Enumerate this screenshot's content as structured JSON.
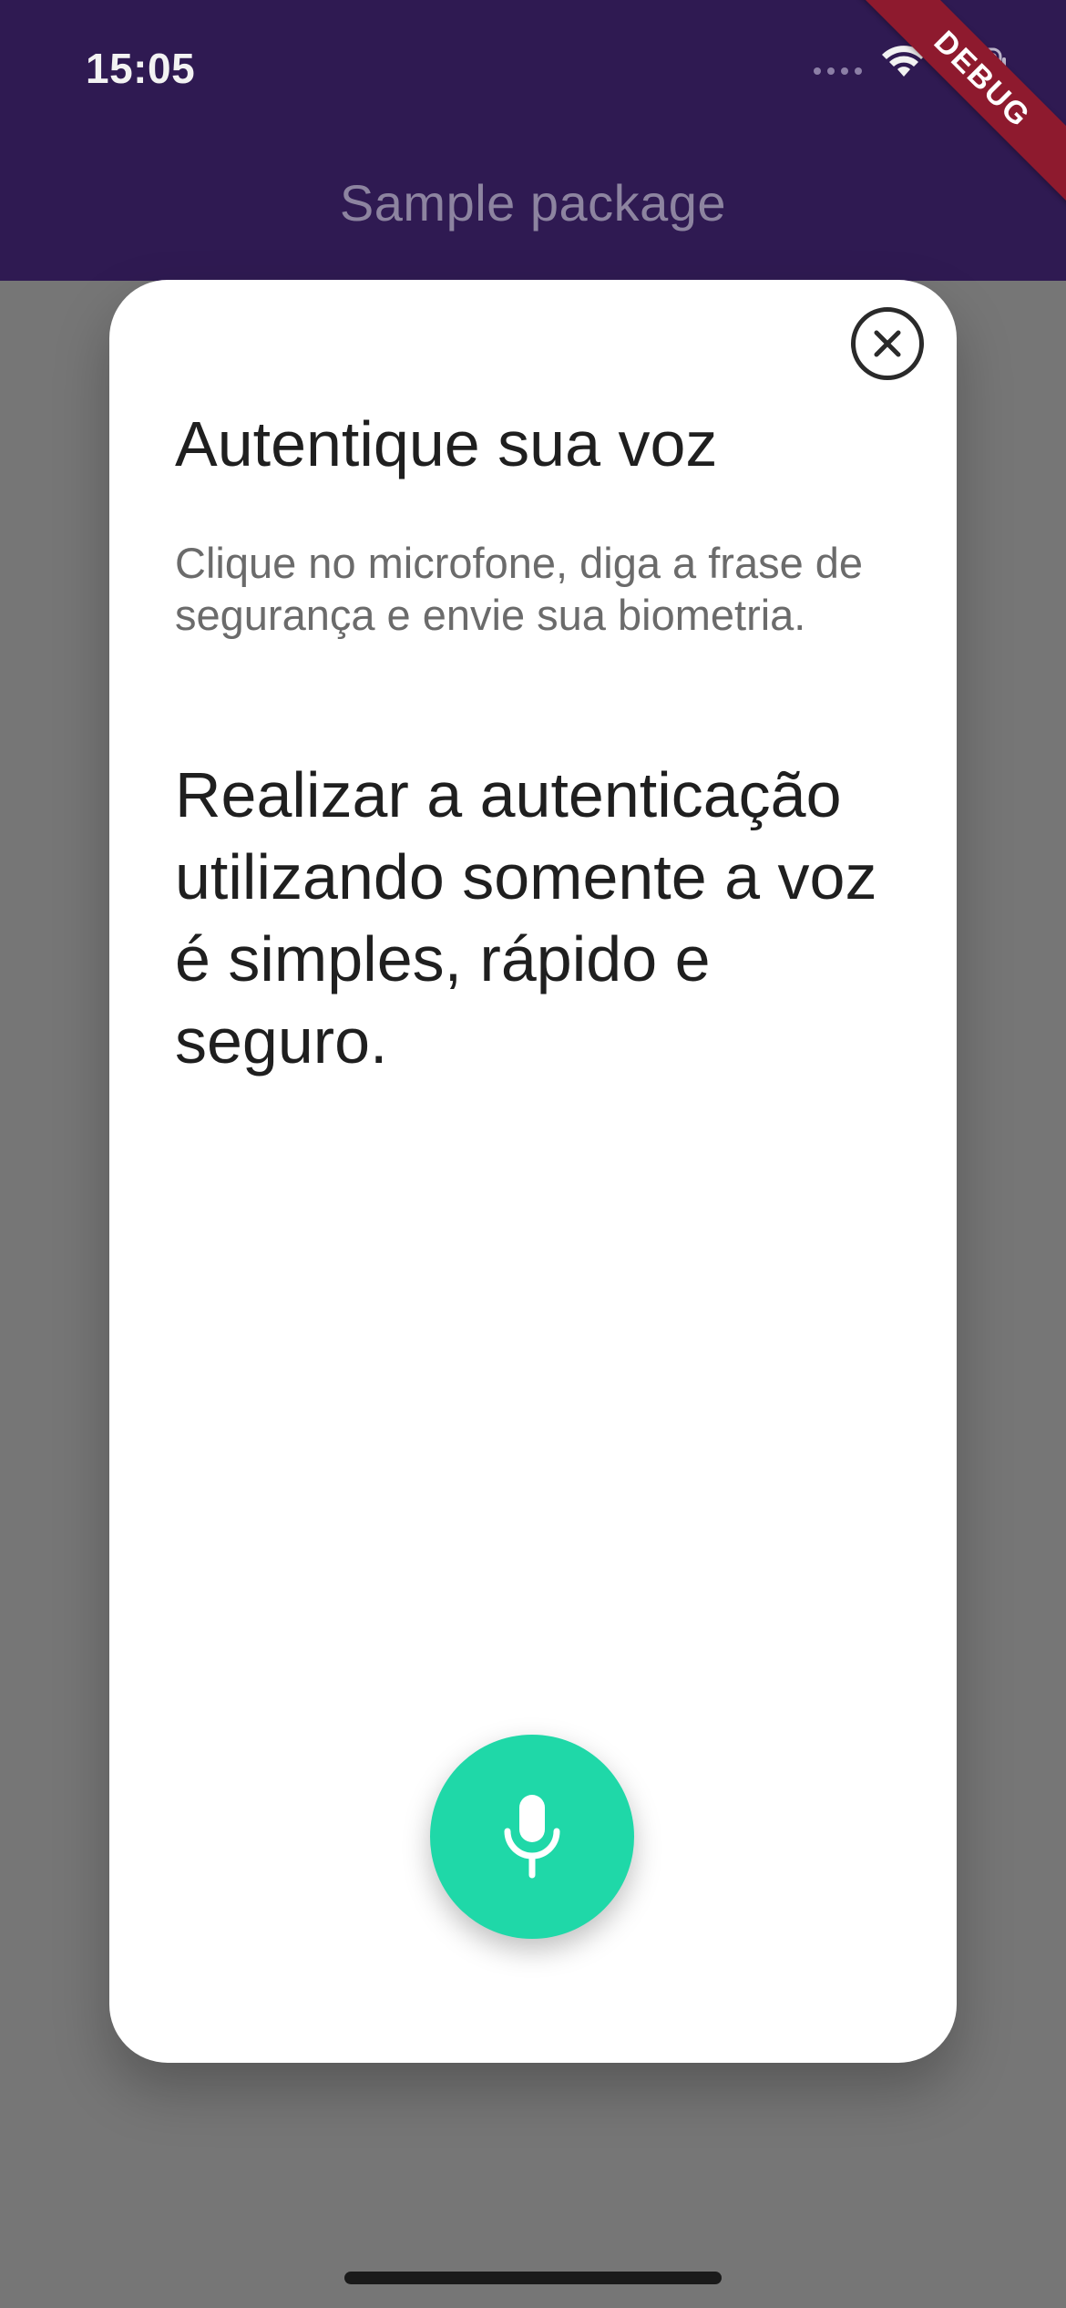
{
  "status_bar": {
    "time": "15:05"
  },
  "app_bar": {
    "title": "Sample package"
  },
  "debug_banner": {
    "label": "DEBUG"
  },
  "modal": {
    "title": "Autentique sua voz",
    "subtitle": "Clique no microfone, diga a frase de segurança e envie sua biometria.",
    "statement": "Realizar a autenticação utilizando somente a voz é simples, rápido e seguro.",
    "close_icon": "close-circle-icon",
    "mic_icon": "microphone-icon"
  },
  "colors": {
    "app_bar": "#2f1a52",
    "overlay": "#767676",
    "mic_button": "#1fd8a8",
    "debug_ribbon": "#8e1a2e"
  }
}
